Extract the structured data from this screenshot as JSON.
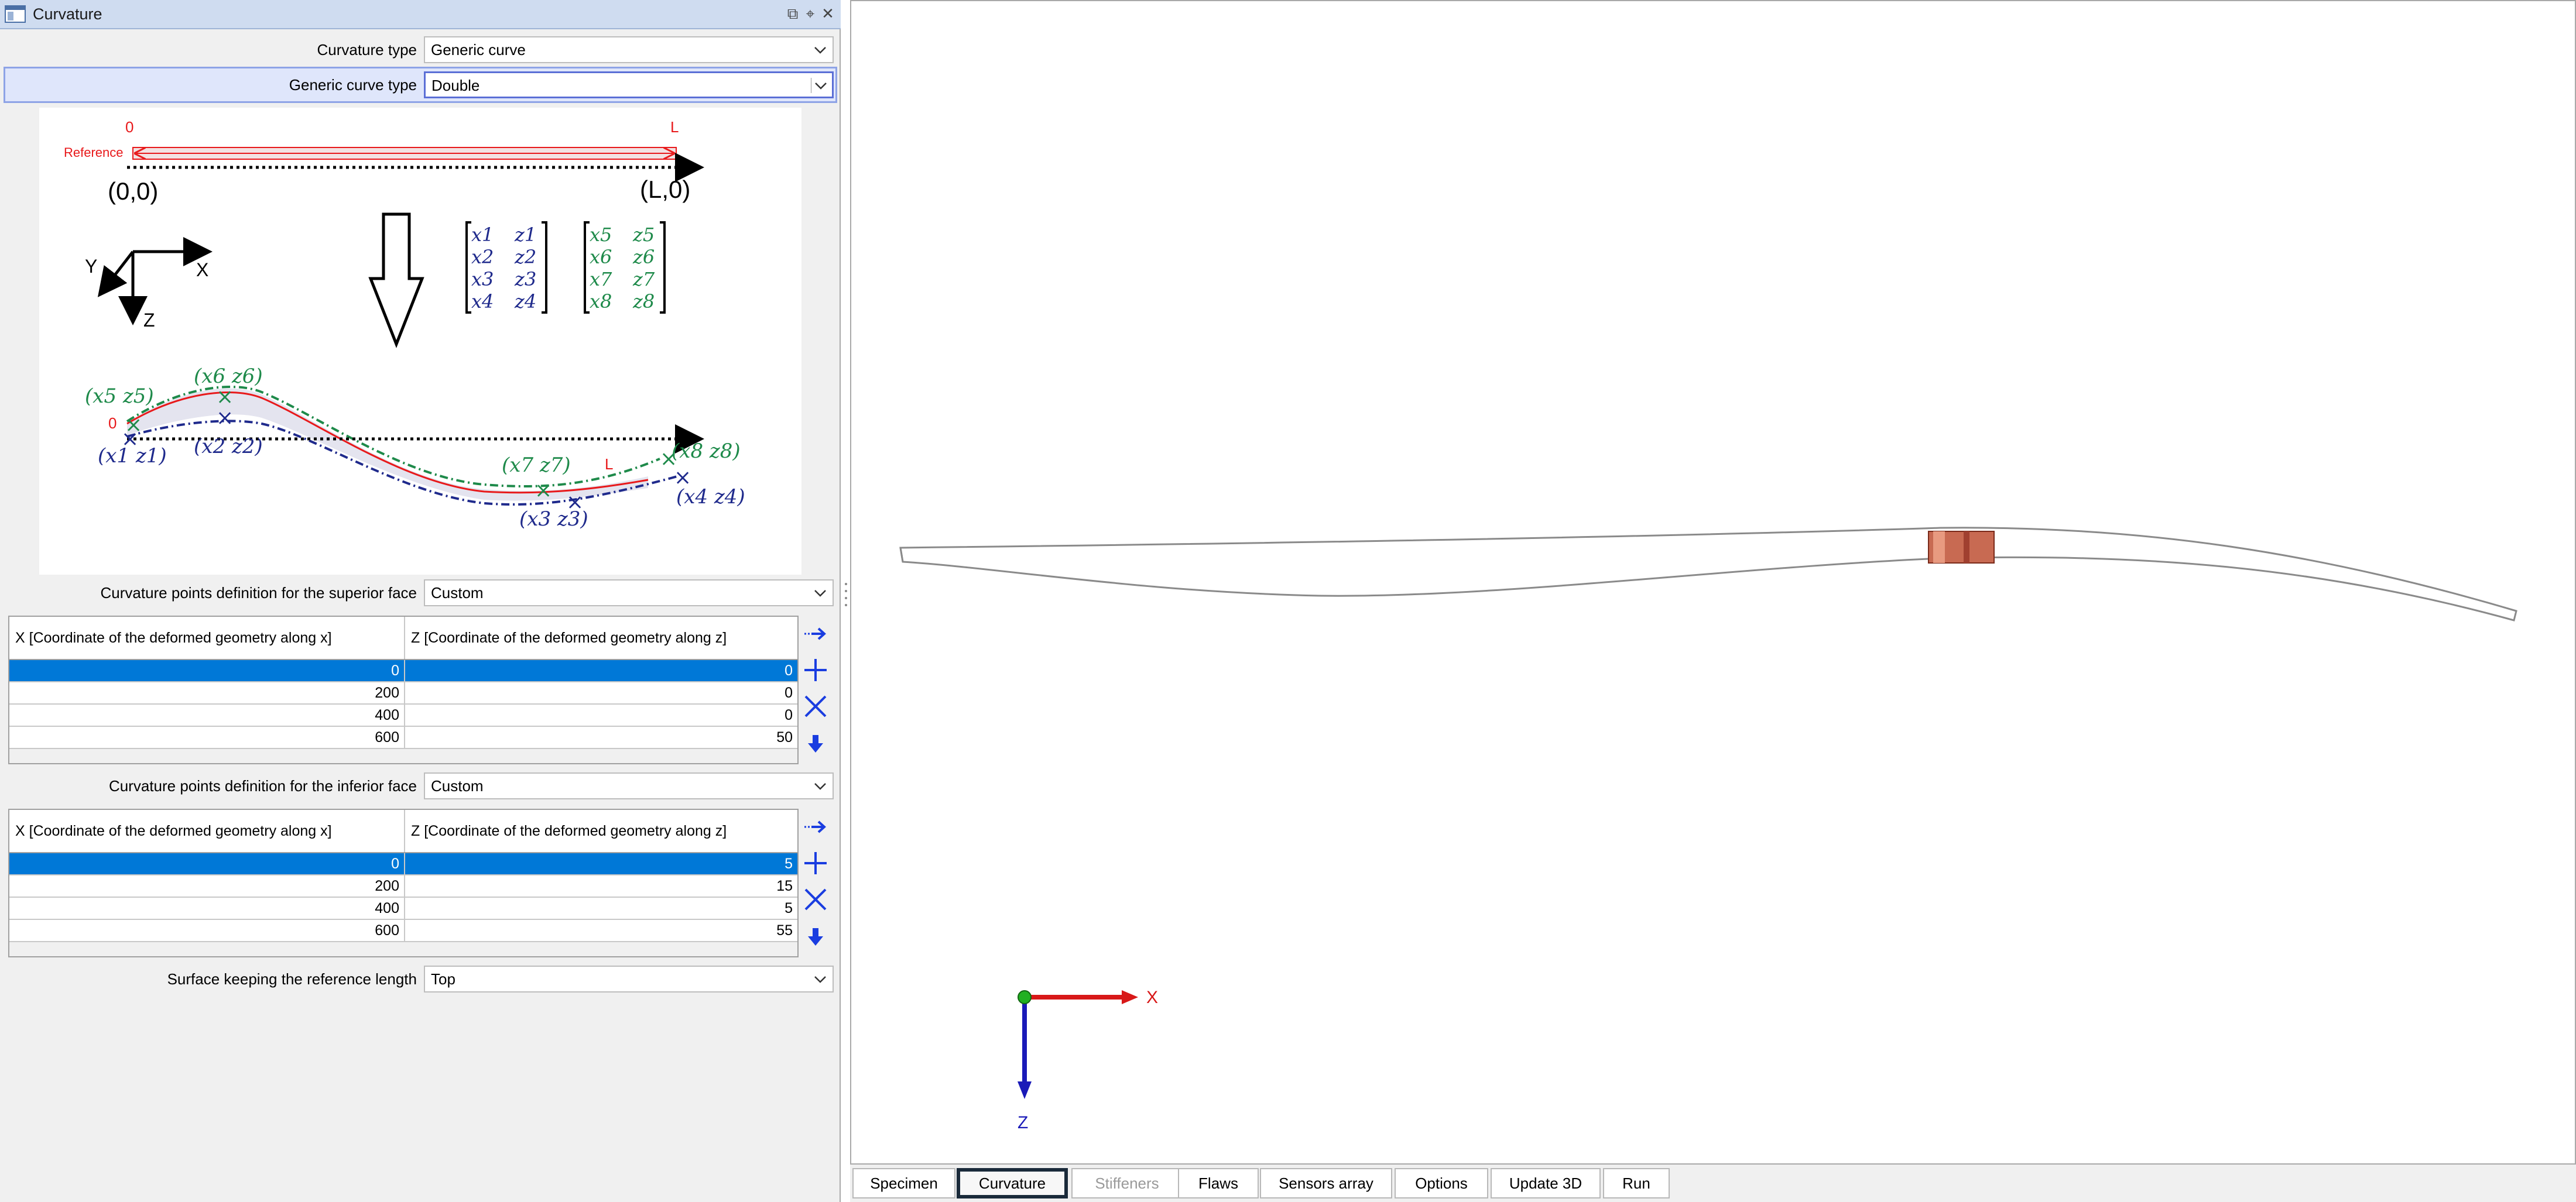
{
  "window": {
    "title": "Curvature"
  },
  "form": {
    "curvature_type": {
      "label": "Curvature type",
      "value": "Generic curve"
    },
    "generic_curve_type": {
      "label": "Generic curve type",
      "value": "Double"
    },
    "superior": {
      "label": "Curvature points definition for the superior face",
      "value": "Custom"
    },
    "inferior": {
      "label": "Curvature points definition for the inferior face",
      "value": "Custom"
    },
    "surface_keeping": {
      "label": "Surface keeping the reference length",
      "value": "Top"
    }
  },
  "schema": {
    "label_0": "0",
    "label_L": "L",
    "reference": "Reference",
    "origin": "(0,0)",
    "end": "(L,0)",
    "axis_x": "X",
    "axis_y": "Y",
    "axis_z": "Z",
    "matrix_left": [
      [
        "x1",
        "z1"
      ],
      [
        "x2",
        "z2"
      ],
      [
        "x3",
        "z3"
      ],
      [
        "x4",
        "z4"
      ]
    ],
    "matrix_right": [
      [
        "x5",
        "z5"
      ],
      [
        "x6",
        "z6"
      ],
      [
        "x7",
        "z7"
      ],
      [
        "x8",
        "z8"
      ]
    ],
    "pt_top": [
      "(x5 z5)",
      "(x6 z6)",
      "(x7 z7)",
      "(x8 z8)"
    ],
    "pt_bot": [
      "(x1 z1)",
      "(x2 z2)",
      "(x3 z3)",
      "(x4 z4)"
    ],
    "curve_0": "0",
    "curve_L": "L"
  },
  "superior_table": {
    "col_x": "X [Coordinate of the deformed geometry along x]",
    "col_z": "Z [Coordinate of the deformed geometry along z]",
    "rows": [
      [
        "0",
        "0"
      ],
      [
        "200",
        "0"
      ],
      [
        "400",
        "0"
      ],
      [
        "600",
        "50"
      ]
    ]
  },
  "inferior_table": {
    "col_x": "X [Coordinate of the deformed geometry along x]",
    "col_z": "Z [Coordinate of the deformed geometry along z]",
    "rows": [
      [
        "0",
        "5"
      ],
      [
        "200",
        "15"
      ],
      [
        "400",
        "5"
      ],
      [
        "600",
        "55"
      ]
    ]
  },
  "viewport": {
    "axis_x": "X",
    "axis_z": "Z"
  },
  "tabs": [
    {
      "label": "Specimen",
      "state": "normal"
    },
    {
      "label": "Curvature",
      "state": "active"
    },
    {
      "label": "Stiffeners",
      "state": "disabled"
    },
    {
      "label": "Flaws",
      "state": "normal"
    },
    {
      "label": "Sensors array",
      "state": "normal"
    },
    {
      "label": "Options",
      "state": "normal"
    },
    {
      "label": "Update 3D",
      "state": "normal"
    },
    {
      "label": "Run",
      "state": "normal"
    }
  ],
  "colors": {
    "selection": "#0078d7",
    "reference_red": "#e8191b",
    "top_green": "#1e8a4a",
    "bottom_blue": "#1f2a8c",
    "action_blue": "#1a3de0"
  }
}
